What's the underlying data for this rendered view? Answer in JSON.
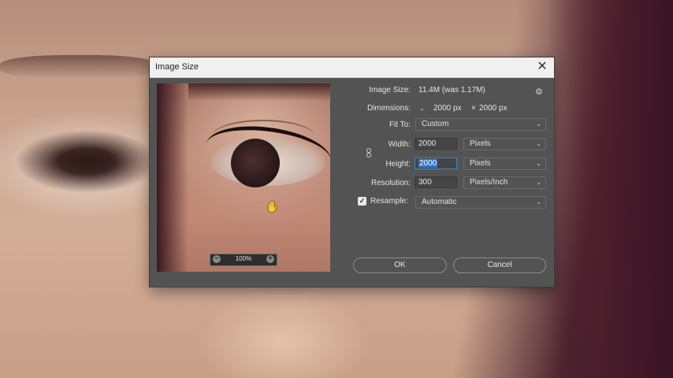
{
  "dialog": {
    "title": "Image Size",
    "close_glyph": "✕"
  },
  "preview": {
    "zoom_value": "100%",
    "zoom_out_glyph": "−",
    "zoom_in_glyph": "+",
    "cursor_glyph": "✋"
  },
  "info": {
    "image_size_label": "Image Size:",
    "image_size_value": "11.4M (was 1.17M)",
    "dimensions_label": "Dimensions:",
    "dimensions_width": "2000 px",
    "dimensions_x": "×",
    "dimensions_height": "2000 px"
  },
  "fit_to": {
    "label": "Fit To:",
    "value": "Custom"
  },
  "width": {
    "label": "Width:",
    "value": "2000",
    "unit": "Pixels"
  },
  "height": {
    "label": "Height:",
    "value": "2000",
    "unit": "Pixels"
  },
  "resolution": {
    "label": "Resolution:",
    "value": "300",
    "unit": "Pixels/Inch"
  },
  "resample": {
    "label": "Resample:",
    "checked": true,
    "check_glyph": "✓",
    "value": "Automatic"
  },
  "buttons": {
    "ok": "OK",
    "cancel": "Cancel"
  },
  "icons": {
    "gear": "gear-icon",
    "chain": "link-chain-icon",
    "chevron": "chevron-down-icon",
    "chevron_glyph": "⌄"
  }
}
